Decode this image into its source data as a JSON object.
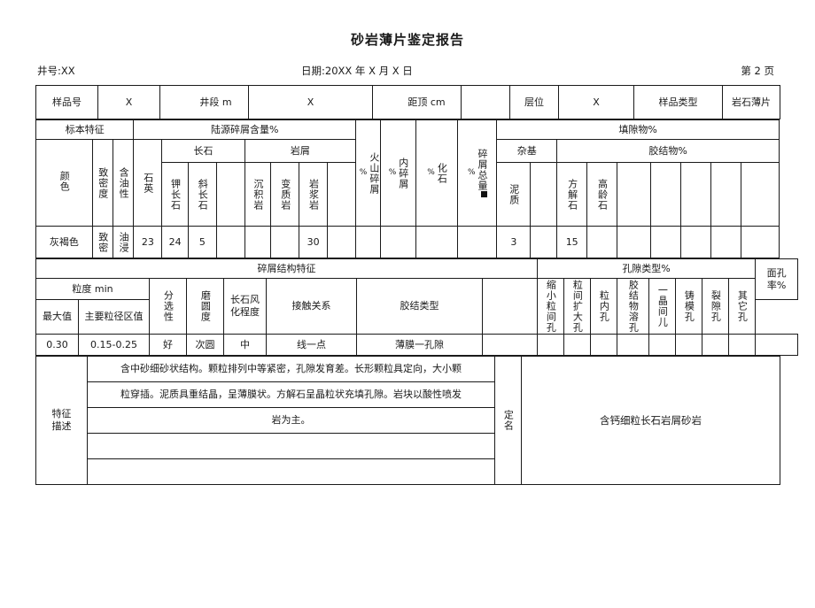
{
  "document": {
    "title": "砂岩薄片鉴定报告",
    "well_label": "井号:XX",
    "date_label": "日期:20XX 年 X 月 X 日",
    "page_label": "第 2 页"
  },
  "sample_row": {
    "sample_no_label": "样品号",
    "sample_no_value": "X",
    "interval_label": "井段 m",
    "interval_value": "X",
    "top_distance_label": "距顶 cm",
    "top_distance_value": "",
    "horizon_label": "层位",
    "horizon_value": "X",
    "sample_type_label": "样品类型",
    "sample_type_value": "岩石薄片"
  },
  "composition": {
    "specimen_group": "标本特征",
    "terrigenous_group": "陆源碎屑含量%",
    "filling_group": "填隙物%",
    "matrix_group": "杂基",
    "cement_group": "胶结物%",
    "feldspar_group": "长石",
    "rockfragment_group": "岩屑",
    "columns": {
      "color": "颜色",
      "density": "致密度",
      "oil_bearing": "含油性",
      "quartz": "石英",
      "k_feldspar": "钾长石",
      "plagioclase": "斜长石",
      "feldspar_other": "",
      "sedimentary": "沉积岩",
      "metamorphic": "变质岩",
      "magmatic": "岩浆岩",
      "rock_other": "",
      "volcaniclastic": "火山碎屑",
      "intraclast": "内碎屑",
      "fossil": "化石",
      "clastic_total": "碎屑总量",
      "argillaceous": "泥质",
      "matrix_other": "",
      "calcite": "方解石",
      "kaolinite": "高龄石",
      "cement_c3": "",
      "cement_c4": "",
      "cement_c5": "",
      "cement_c6": "",
      "cement_c7": "",
      "percent": "%"
    },
    "values": {
      "color": "灰褐色",
      "density": "致密",
      "oil_bearing": "油浸",
      "quartz": "23",
      "k_feldspar": "24",
      "plagioclase": "5",
      "feldspar_other": "",
      "sedimentary": "",
      "metamorphic": "",
      "magmatic": "30",
      "rock_other": "",
      "volcaniclastic": "",
      "intraclast": "",
      "fossil": "",
      "clastic_total": "",
      "argillaceous": "3",
      "matrix_other": "",
      "calcite": "15",
      "kaolinite": "",
      "cement_c3": "",
      "cement_c4": "",
      "cement_c5": "",
      "cement_c6": "",
      "cement_c7": ""
    }
  },
  "structure": {
    "clastic_group": "碎屑结构特征",
    "pore_group": "孔隙类型%",
    "grain_size_group": "粒度 min",
    "columns": {
      "max_value": "最大值",
      "main_range": "主要粒径区值",
      "sorting": "分选性",
      "roundness": "磨圆度",
      "feldspar_weathering": "长石风化程度",
      "contact": "接触关系",
      "cement_type": "胶结类型",
      "extra": "",
      "pore_reduced": "缩小粒间孔",
      "pore_enlarged": "粒间扩大孔",
      "pore_intragranular": "粒内孔",
      "pore_cement_dissolution": "胶结物溶孔",
      "pore_intercrystal": "一晶间儿",
      "pore_mold": "铸模孔",
      "pore_fracture": "裂隙孔",
      "pore_other": "其它孔",
      "surface_porosity": "面孔率%"
    },
    "values": {
      "max_value": "0.30",
      "main_range": "0.15-0.25",
      "sorting": "好",
      "roundness": "次圆",
      "feldspar_weathering": "中",
      "contact": "线一点",
      "cement_type": "薄膜一孔隙",
      "extra": "",
      "pore_reduced": "",
      "pore_enlarged": "",
      "pore_intragranular": "",
      "pore_cement_dissolution": "",
      "pore_intercrystal": "",
      "pore_mold": "",
      "pore_fracture": "",
      "pore_other": "",
      "surface_porosity": ""
    }
  },
  "description": {
    "label": "特征描述",
    "lines": [
      "含中砂细砂状结构。颗粒排列中等紧密，孔隙发育差。长形颗粒具定向，大小颗",
      "粒穿插。泥质具重结晶，呈薄膜状。方解石呈晶粒状充填孔隙。岩块以酸性喷发",
      "岩为主。",
      "",
      ""
    ],
    "naming_label": "定名",
    "naming_value": "含钙细粒长石岩屑砂岩"
  }
}
